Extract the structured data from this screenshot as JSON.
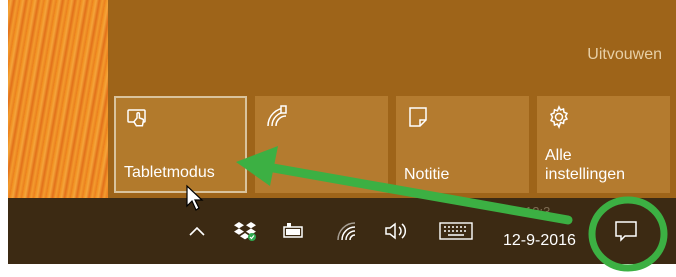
{
  "action_center": {
    "expand_label": "Uitvouwen",
    "tiles": [
      {
        "label": "Tabletmodus",
        "icon": "tablet-mode-icon",
        "selected": true
      },
      {
        "label": "",
        "icon": "network-icon",
        "selected": false
      },
      {
        "label": "Notitie",
        "icon": "note-icon",
        "selected": false
      },
      {
        "label": "Alle instellingen",
        "icon": "gear-icon",
        "selected": false
      }
    ]
  },
  "taskbar": {
    "icons": [
      "chevron-up-icon",
      "dropbox-icon",
      "battery-icon",
      "wifi-icon",
      "volume-icon",
      "keyboard-icon"
    ],
    "date": "12-9-2016",
    "time": "12:3",
    "notification_icon": "action-center-icon"
  },
  "colors": {
    "accent_bg": "#9e6419",
    "tile_bg": "#b47b2f",
    "taskbar_bg": "#3c2a13",
    "annotation_green": "#3cb043"
  }
}
